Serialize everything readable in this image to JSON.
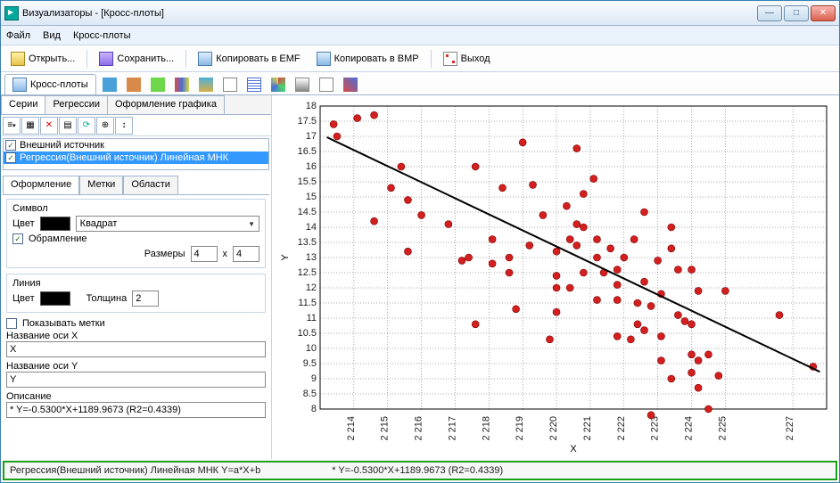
{
  "window": {
    "title": "Визуализаторы - [Кросс-плоты]",
    "btn_min": "—",
    "btn_max": "□",
    "btn_close": "✕"
  },
  "menu": {
    "file": "Файл",
    "view": "Вид",
    "crossplots": "Кросс-плоты"
  },
  "toolbar": {
    "open": "Открыть...",
    "save": "Сохранить...",
    "copy_emf": "Копировать в EMF",
    "copy_bmp": "Копировать в BMP",
    "exit": "Выход"
  },
  "main_tab": "Кросс-плоты",
  "subtabs": {
    "series": "Серии",
    "regressions": "Регрессии",
    "format": "Оформление графика"
  },
  "series_list": {
    "item0_check": "✓",
    "item0": "Внешний источник",
    "item1_check": "✓",
    "item1": "Регрессия(Внешний источник) Линейная МНК"
  },
  "inner_tabs": {
    "format": "Оформление",
    "labels": "Метки",
    "areas": "Области"
  },
  "form": {
    "symbol_lbl": "Символ",
    "color_lbl": "Цвет",
    "shape": "Квадрат",
    "border_chk": "✓",
    "border_lbl": "Обрамление",
    "sizes_lbl": "Размеры",
    "size_w": "4",
    "size_sep": "x",
    "size_h": "4",
    "line_lbl": "Линия",
    "line_color_lbl": "Цвет",
    "thickness_lbl": "Толщина",
    "thickness": "2",
    "showlabels_lbl": "Показывать метки",
    "xaxis_lbl": "Название оси X",
    "xaxis_val": "X",
    "yaxis_lbl": "Название оси Y",
    "yaxis_val": "Y",
    "desc_lbl": "Описание",
    "desc_val": "* Y=-0.5300*X+1189.9673 (R2=0.4339)"
  },
  "status": {
    "left": "Регрессия(Внешний источник) Линейная МНК Y=a*X+b",
    "right": "* Y=-0.5300*X+1189.9673 (R2=0.4339)"
  },
  "chart_data": {
    "type": "scatter",
    "xlabel": "X",
    "ylabel": "Y",
    "xlim": [
      2213,
      2228
    ],
    "ylim": [
      8,
      18
    ],
    "x_ticks": [
      2214,
      2215,
      2216,
      2217,
      2218,
      2219,
      2220,
      2221,
      2222,
      2223,
      2224,
      2225,
      2227
    ],
    "x_tick_labels": [
      "2 214",
      "2 215",
      "2 216",
      "2 217",
      "2 218",
      "2 219",
      "2 220",
      "2 221",
      "2 222",
      "2 223",
      "2 224",
      "2 225",
      "2 227"
    ],
    "y_ticks": [
      8,
      8.5,
      9,
      9.5,
      10,
      10.5,
      11,
      11.5,
      12,
      12.5,
      13,
      13.5,
      14,
      14.5,
      15,
      15.5,
      16,
      16.5,
      17,
      17.5,
      18
    ],
    "series": [
      {
        "name": "Внешний источник",
        "type": "scatter",
        "color": "#d41f1f",
        "points": [
          [
            2213.4,
            17.4
          ],
          [
            2213.5,
            17.0
          ],
          [
            2214.1,
            17.6
          ],
          [
            2214.6,
            17.7
          ],
          [
            2215.1,
            15.3
          ],
          [
            2214.6,
            14.2
          ],
          [
            2215.4,
            16.0
          ],
          [
            2215.6,
            14.9
          ],
          [
            2215.6,
            13.2
          ],
          [
            2216.0,
            14.4
          ],
          [
            2216.8,
            14.1
          ],
          [
            2217.2,
            12.9
          ],
          [
            2217.4,
            13.0
          ],
          [
            2217.6,
            10.8
          ],
          [
            2217.6,
            16.0
          ],
          [
            2218.4,
            15.3
          ],
          [
            2218.1,
            13.6
          ],
          [
            2218.1,
            12.8
          ],
          [
            2218.6,
            13.0
          ],
          [
            2218.6,
            12.5
          ],
          [
            2218.8,
            11.3
          ],
          [
            2219.0,
            16.8
          ],
          [
            2219.2,
            13.4
          ],
          [
            2219.3,
            15.4
          ],
          [
            2219.6,
            14.4
          ],
          [
            2219.8,
            10.3
          ],
          [
            2220.0,
            13.2
          ],
          [
            2220.0,
            12.4
          ],
          [
            2220.0,
            12.0
          ],
          [
            2220.0,
            11.2
          ],
          [
            2220.3,
            14.7
          ],
          [
            2220.4,
            13.6
          ],
          [
            2220.4,
            12.0
          ],
          [
            2220.6,
            16.6
          ],
          [
            2220.6,
            14.1
          ],
          [
            2220.6,
            13.4
          ],
          [
            2220.8,
            15.1
          ],
          [
            2220.8,
            14.0
          ],
          [
            2220.8,
            12.5
          ],
          [
            2221.1,
            15.6
          ],
          [
            2221.2,
            13.6
          ],
          [
            2221.2,
            13.0
          ],
          [
            2221.2,
            11.6
          ],
          [
            2221.4,
            12.5
          ],
          [
            2221.6,
            13.3
          ],
          [
            2221.8,
            12.6
          ],
          [
            2221.8,
            12.1
          ],
          [
            2221.8,
            11.6
          ],
          [
            2221.8,
            10.4
          ],
          [
            2222.0,
            13.0
          ],
          [
            2222.2,
            10.3
          ],
          [
            2222.3,
            13.6
          ],
          [
            2222.4,
            11.5
          ],
          [
            2222.4,
            10.8
          ],
          [
            2222.6,
            14.5
          ],
          [
            2222.6,
            12.2
          ],
          [
            2222.6,
            10.6
          ],
          [
            2222.8,
            11.4
          ],
          [
            2222.8,
            7.8
          ],
          [
            2223.0,
            12.9
          ],
          [
            2223.1,
            11.8
          ],
          [
            2223.1,
            10.4
          ],
          [
            2223.1,
            9.6
          ],
          [
            2223.4,
            14.0
          ],
          [
            2223.4,
            13.3
          ],
          [
            2223.4,
            9.0
          ],
          [
            2223.6,
            12.6
          ],
          [
            2223.6,
            11.1
          ],
          [
            2223.8,
            10.9
          ],
          [
            2224.0,
            12.6
          ],
          [
            2224.0,
            10.8
          ],
          [
            2224.0,
            9.8
          ],
          [
            2224.0,
            9.2
          ],
          [
            2224.2,
            11.9
          ],
          [
            2224.2,
            9.6
          ],
          [
            2224.2,
            8.7
          ],
          [
            2224.5,
            9.8
          ],
          [
            2224.5,
            8.0
          ],
          [
            2224.8,
            9.1
          ],
          [
            2225.0,
            11.9
          ],
          [
            2226.6,
            11.1
          ],
          [
            2227.6,
            9.4
          ]
        ]
      },
      {
        "name": "Регрессия",
        "type": "line",
        "color": "#000",
        "points": [
          [
            2213.2,
            16.97
          ],
          [
            2227.8,
            9.23
          ]
        ],
        "equation": "Y=-0.5300*X+1189.9673",
        "r2": 0.4339
      }
    ]
  }
}
